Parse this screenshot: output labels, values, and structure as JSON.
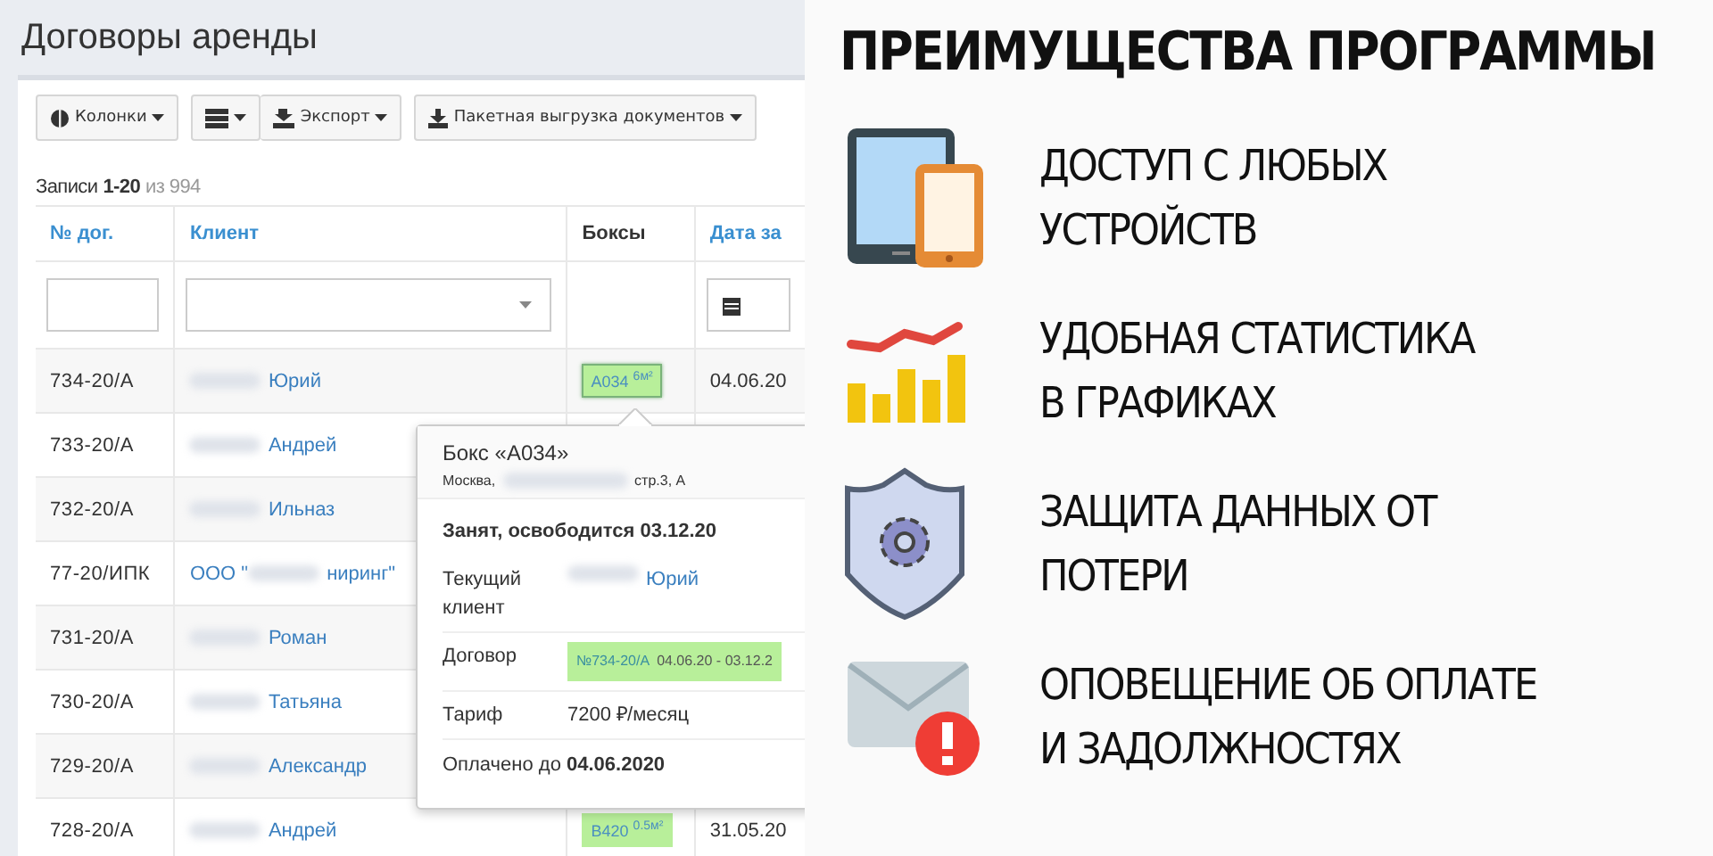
{
  "page": {
    "title": "Договоры аренды"
  },
  "toolbar": [
    [
      {
        "kind": "columns",
        "label": "Колонки"
      }
    ],
    [
      {
        "kind": "view"
      },
      {
        "kind": "export",
        "label": "Экспорт"
      }
    ],
    [
      {
        "kind": "download",
        "label": "Пакетная выгрузка документов"
      }
    ]
  ],
  "records": {
    "label": "Записи",
    "range": "1-20",
    "total": "из 994"
  },
  "table": {
    "columns": [
      {
        "label": "№ дог.",
        "sortable": true
      },
      {
        "label": "Клиент",
        "sortable": true
      },
      {
        "label": "Боксы",
        "sortable": false
      },
      {
        "label": "Дата за",
        "sortable": true
      }
    ],
    "filters": [
      {
        "kind": "text"
      },
      {
        "kind": "select"
      },
      {
        "kind": "none"
      },
      {
        "kind": "date"
      }
    ],
    "rows": [
      {
        "number": "734-20/А",
        "client": "Юрий",
        "box": {
          "code": "А034 $^{6м²}$",
          "active": true
        },
        "date": "04.06.20"
      },
      {
        "number": "733-20/А",
        "client": "Андрей"
      },
      {
        "number": "732-20/А",
        "client": "Ильназ"
      },
      {
        "number": "77-20/ИПК",
        "client_before": "ООО \"",
        "client": "ниринг\""
      },
      {
        "number": "731-20/А",
        "client": "Роман"
      },
      {
        "number": "730-20/А",
        "client": "Татьяна"
      },
      {
        "number": "729-20/А",
        "client": "Александр"
      },
      {
        "number": "728-20/А",
        "client": "Андрей",
        "box": {
          "code": "В420 $^{0.5м²}$",
          "active": false
        },
        "date": "31.05.20"
      }
    ]
  },
  "popover": {
    "title": "Бокс «А034»",
    "address_start": "Москва,",
    "address_end": "стр.3, А",
    "status": "Занят, освободится 03.12.20",
    "fields": [
      {
        "kind": "client",
        "label": "Текущий клиент",
        "value": "Юрий"
      },
      {
        "kind": "contract",
        "label": "Договор",
        "value": "№734-20/А",
        "period": "04.06.20 - 03.12.2"
      },
      {
        "kind": "text",
        "label": "Тариф",
        "value": "7200 ₽/месяц"
      }
    ],
    "paid": "Оплачено до **04.06.2020**"
  },
  "promo": {
    "title": "ПРЕИМУЩЕСТВА ПРОГРАММЫ",
    "items": [
      {
        "kind": "devices",
        "lines": [
          "ДОСТУП С ЛЮБЫХ",
          "УСТРОЙСТВ"
        ]
      },
      {
        "kind": "chart",
        "lines": [
          "УДОБНАЯ СТАТИСТИКА",
          "В ГРАФИКАХ"
        ]
      },
      {
        "kind": "shield",
        "lines": [
          "ЗАЩИТА ДАННЫХ ОТ",
          "ПОТЕРИ"
        ]
      },
      {
        "kind": "mail",
        "lines": [
          "ОПОВЕЩЕНИЕ ОБ ОПЛАТЕ",
          "И ЗАДОЛЖНОСТЯХ"
        ]
      }
    ]
  }
}
